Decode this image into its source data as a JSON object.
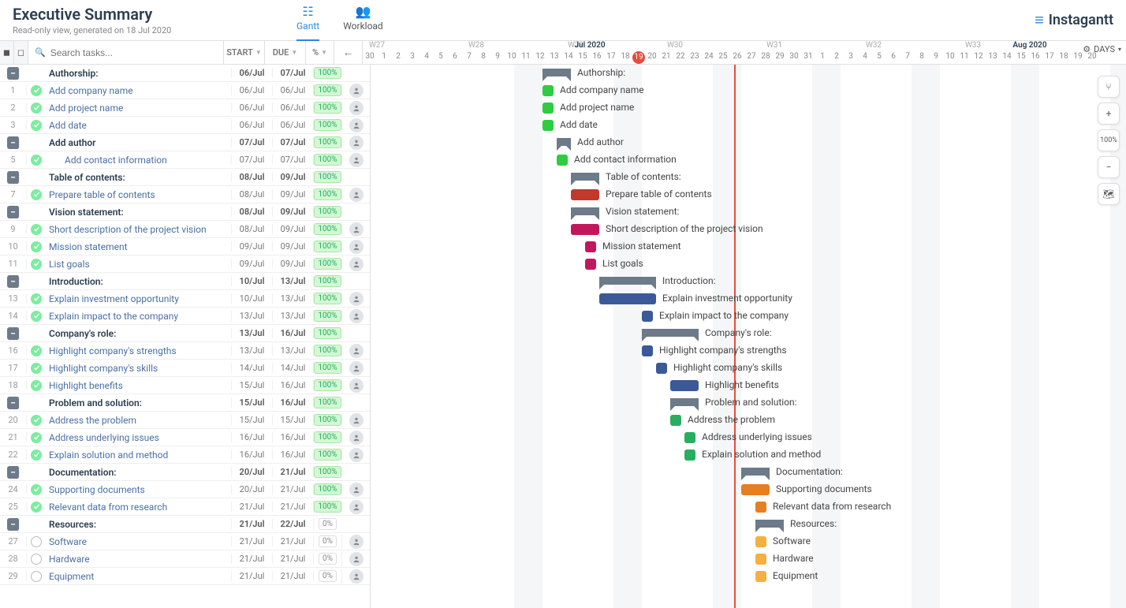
{
  "header": {
    "title": "Executive Summary",
    "subtitle": "Read-only view, generated on 18 Jul 2020",
    "tabs": {
      "gantt": "Gantt",
      "workload": "Workload"
    },
    "brand": "Instagantt"
  },
  "toolbar": {
    "search_placeholder": "Search tasks...",
    "col_start": "START",
    "col_due": "DUE",
    "col_pct": "%",
    "days_label": "DAYS"
  },
  "zoom_pct": "100%",
  "timeline": {
    "start_date": "2020-06-30",
    "today_index": 19,
    "weeks": [
      "W27",
      "W28",
      "W29",
      "W30",
      "W31",
      "W32",
      "W33"
    ],
    "week_positions": [
      1,
      8,
      15,
      22,
      29,
      36,
      43
    ],
    "month_labels": [
      {
        "text": "Jul 2020",
        "index": 16
      },
      {
        "text": "Aug 2020",
        "index": 47
      }
    ],
    "days": [
      30,
      1,
      2,
      3,
      4,
      5,
      6,
      7,
      8,
      9,
      10,
      11,
      12,
      13,
      14,
      15,
      16,
      17,
      18,
      19,
      20,
      21,
      22,
      23,
      24,
      25,
      26,
      27,
      28,
      29,
      30,
      31,
      1,
      2,
      3,
      4,
      5,
      6,
      7,
      8,
      9,
      10,
      11,
      12,
      13,
      14,
      15,
      16,
      17,
      18,
      19,
      20
    ],
    "weekends": [
      4,
      5,
      11,
      12,
      18,
      19,
      25,
      26,
      32,
      33,
      39,
      40,
      46,
      47
    ]
  },
  "tasks": [
    {
      "type": "group",
      "name": "Authorship:",
      "start": "06/Jul",
      "due": "07/Jul",
      "pct": "100%",
      "bar_start": 6,
      "bar_len": 2,
      "color": "#6c7a89"
    },
    {
      "num": "1",
      "type": "task",
      "name": "Add company name",
      "start": "06/Jul",
      "due": "06/Jul",
      "pct": "100%",
      "done": true,
      "bar_start": 6,
      "bar_len": 1,
      "color": "#2ecc40",
      "assign": true
    },
    {
      "num": "2",
      "type": "task",
      "name": "Add project name",
      "start": "06/Jul",
      "due": "06/Jul",
      "pct": "100%",
      "done": true,
      "bar_start": 6,
      "bar_len": 1,
      "color": "#2ecc40",
      "assign": true
    },
    {
      "num": "3",
      "type": "task",
      "name": "Add date",
      "start": "06/Jul",
      "due": "06/Jul",
      "pct": "100%",
      "done": true,
      "bar_start": 6,
      "bar_len": 1,
      "color": "#2ecc40",
      "assign": true
    },
    {
      "type": "subgroup",
      "name": "Add author",
      "start": "07/Jul",
      "due": "07/Jul",
      "pct": "100%",
      "bar_start": 7,
      "bar_len": 1,
      "color": "#6c7a89",
      "assign": true
    },
    {
      "num": "5",
      "type": "task",
      "name": "Add contact information",
      "start": "07/Jul",
      "due": "07/Jul",
      "pct": "100%",
      "done": true,
      "bar_start": 7,
      "bar_len": 1,
      "color": "#2ecc40",
      "indent": 1,
      "assign": true
    },
    {
      "type": "group",
      "name": "Table of contents:",
      "start": "08/Jul",
      "due": "09/Jul",
      "pct": "100%",
      "bar_start": 8,
      "bar_len": 2,
      "color": "#6c7a89"
    },
    {
      "num": "7",
      "type": "task",
      "name": "Prepare table of contents",
      "start": "08/Jul",
      "due": "09/Jul",
      "pct": "100%",
      "done": true,
      "bar_start": 8,
      "bar_len": 2,
      "color": "#c0392b",
      "assign": true
    },
    {
      "type": "group",
      "name": "Vision statement:",
      "start": "08/Jul",
      "due": "09/Jul",
      "pct": "100%",
      "bar_start": 8,
      "bar_len": 2,
      "color": "#6c7a89"
    },
    {
      "num": "9",
      "type": "task",
      "name": "Short description of the project vision",
      "start": "08/Jul",
      "due": "09/Jul",
      "pct": "100%",
      "done": true,
      "bar_start": 8,
      "bar_len": 2,
      "color": "#c2185b",
      "assign": true
    },
    {
      "num": "10",
      "type": "task",
      "name": "Mission statement",
      "start": "09/Jul",
      "due": "09/Jul",
      "pct": "100%",
      "done": true,
      "bar_start": 9,
      "bar_len": 1,
      "color": "#c2185b",
      "assign": true
    },
    {
      "num": "11",
      "type": "task",
      "name": "List goals",
      "start": "09/Jul",
      "due": "09/Jul",
      "pct": "100%",
      "done": true,
      "bar_start": 9,
      "bar_len": 1,
      "color": "#c2185b",
      "assign": true
    },
    {
      "type": "group",
      "name": "Introduction:",
      "start": "10/Jul",
      "due": "13/Jul",
      "pct": "100%",
      "bar_start": 10,
      "bar_len": 4,
      "color": "#6c7a89"
    },
    {
      "num": "13",
      "type": "task",
      "name": "Explain investment opportunity",
      "start": "10/Jul",
      "due": "13/Jul",
      "pct": "100%",
      "done": true,
      "bar_start": 10,
      "bar_len": 4,
      "color": "#3b5998",
      "assign": true
    },
    {
      "num": "14",
      "type": "task",
      "name": "Explain impact to the company",
      "start": "13/Jul",
      "due": "13/Jul",
      "pct": "100%",
      "done": true,
      "bar_start": 13,
      "bar_len": 1,
      "color": "#3b5998",
      "assign": true
    },
    {
      "type": "group",
      "name": "Company's role:",
      "start": "13/Jul",
      "due": "16/Jul",
      "pct": "100%",
      "bar_start": 13,
      "bar_len": 4,
      "color": "#6c7a89"
    },
    {
      "num": "16",
      "type": "task",
      "name": "Highlight company's strengths",
      "start": "13/Jul",
      "due": "13/Jul",
      "pct": "100%",
      "done": true,
      "bar_start": 13,
      "bar_len": 1,
      "color": "#3b5998",
      "assign": true
    },
    {
      "num": "17",
      "type": "task",
      "name": "Highlight company's skills",
      "start": "14/Jul",
      "due": "14/Jul",
      "pct": "100%",
      "done": true,
      "bar_start": 14,
      "bar_len": 1,
      "color": "#3b5998",
      "assign": true
    },
    {
      "num": "18",
      "type": "task",
      "name": "Highlight benefits",
      "start": "15/Jul",
      "due": "16/Jul",
      "pct": "100%",
      "done": true,
      "bar_start": 15,
      "bar_len": 2,
      "color": "#3b5998",
      "assign": true
    },
    {
      "type": "group",
      "name": "Problem and solution:",
      "start": "15/Jul",
      "due": "16/Jul",
      "pct": "100%",
      "bar_start": 15,
      "bar_len": 2,
      "color": "#6c7a89"
    },
    {
      "num": "20",
      "type": "task",
      "name": "Address the problem",
      "start": "15/Jul",
      "due": "15/Jul",
      "pct": "100%",
      "done": true,
      "bar_start": 15,
      "bar_len": 1,
      "color": "#27ae60",
      "assign": true
    },
    {
      "num": "21",
      "type": "task",
      "name": "Address underlying issues",
      "start": "16/Jul",
      "due": "16/Jul",
      "pct": "100%",
      "done": true,
      "bar_start": 16,
      "bar_len": 1,
      "color": "#27ae60",
      "assign": true
    },
    {
      "num": "22",
      "type": "task",
      "name": "Explain solution and method",
      "start": "16/Jul",
      "due": "16/Jul",
      "pct": "100%",
      "done": true,
      "bar_start": 16,
      "bar_len": 1,
      "color": "#27ae60",
      "assign": true
    },
    {
      "type": "group",
      "name": "Documentation:",
      "start": "20/Jul",
      "due": "21/Jul",
      "pct": "100%",
      "bar_start": 20,
      "bar_len": 2,
      "color": "#6c7a89"
    },
    {
      "num": "24",
      "type": "task",
      "name": "Supporting documents",
      "start": "20/Jul",
      "due": "21/Jul",
      "pct": "100%",
      "done": true,
      "bar_start": 20,
      "bar_len": 2,
      "color": "#e67e22",
      "assign": true
    },
    {
      "num": "25",
      "type": "task",
      "name": "Relevant data from research",
      "start": "21/Jul",
      "due": "21/Jul",
      "pct": "100%",
      "done": true,
      "bar_start": 21,
      "bar_len": 1,
      "color": "#e67e22",
      "assign": true
    },
    {
      "type": "group",
      "name": "Resources:",
      "start": "21/Jul",
      "due": "22/Jul",
      "pct": "0%",
      "bar_start": 21,
      "bar_len": 2,
      "color": "#6c7a89"
    },
    {
      "num": "27",
      "type": "task",
      "name": "Software",
      "start": "21/Jul",
      "due": "21/Jul",
      "pct": "0%",
      "done": false,
      "bar_start": 21,
      "bar_len": 1,
      "color": "#f5b041",
      "assign": true
    },
    {
      "num": "28",
      "type": "task",
      "name": "Hardware",
      "start": "21/Jul",
      "due": "21/Jul",
      "pct": "0%",
      "done": false,
      "bar_start": 21,
      "bar_len": 1,
      "color": "#f5b041",
      "assign": true
    },
    {
      "num": "29",
      "type": "task",
      "name": "Equipment",
      "start": "21/Jul",
      "due": "21/Jul",
      "pct": "0%",
      "done": false,
      "bar_start": 21,
      "bar_len": 1,
      "color": "#f5b041",
      "assign": true
    }
  ]
}
